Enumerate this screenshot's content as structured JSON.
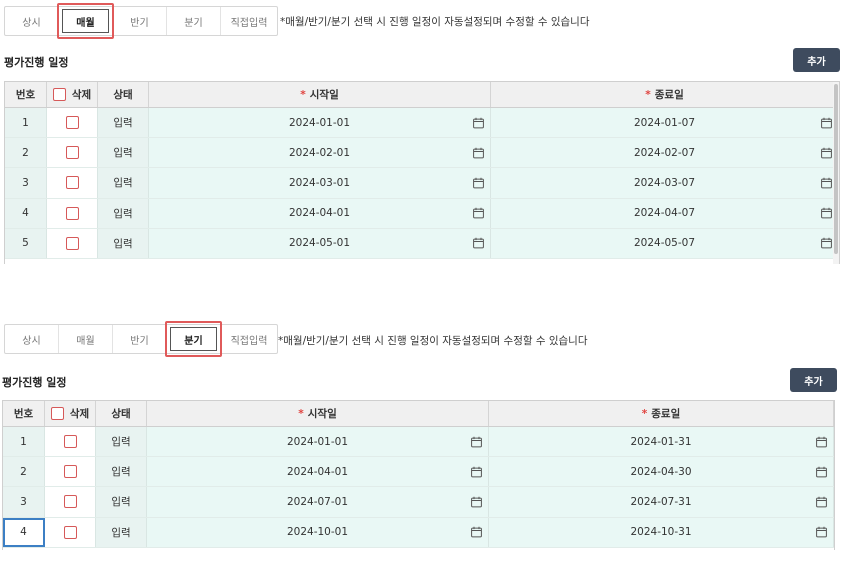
{
  "notice": "*매월/반기/분기 선택 시 진행 일정이 자동설정되며 수정할 수 있습니다",
  "panels": [
    {
      "tabs": [
        {
          "label": "상시",
          "active": false
        },
        {
          "label": "매월",
          "active": true
        },
        {
          "label": "반기",
          "active": false
        },
        {
          "label": "분기",
          "active": false
        },
        {
          "label": "직접입력",
          "active": false
        }
      ],
      "section_title": "평가진행 일정",
      "add_label": "추가",
      "headers": {
        "num": "번호",
        "delete": "삭제",
        "state": "상태",
        "start": "시작일",
        "end": "종료일"
      },
      "rows": [
        {
          "num": "1",
          "state": "입력",
          "start": "2024-01-01",
          "end": "2024-01-07"
        },
        {
          "num": "2",
          "state": "입력",
          "start": "2024-02-01",
          "end": "2024-02-07"
        },
        {
          "num": "3",
          "state": "입력",
          "start": "2024-03-01",
          "end": "2024-03-07"
        },
        {
          "num": "4",
          "state": "입력",
          "start": "2024-04-01",
          "end": "2024-04-07"
        },
        {
          "num": "5",
          "state": "입력",
          "start": "2024-05-01",
          "end": "2024-05-07"
        }
      ]
    },
    {
      "tabs": [
        {
          "label": "상시",
          "active": false
        },
        {
          "label": "매월",
          "active": false
        },
        {
          "label": "반기",
          "active": false
        },
        {
          "label": "분기",
          "active": true
        },
        {
          "label": "직접입력",
          "active": false
        }
      ],
      "section_title": "평가진행 일정",
      "add_label": "추가",
      "headers": {
        "num": "번호",
        "delete": "삭제",
        "state": "상태",
        "start": "시작일",
        "end": "종료일"
      },
      "rows": [
        {
          "num": "1",
          "state": "입력",
          "start": "2024-01-01",
          "end": "2024-01-31"
        },
        {
          "num": "2",
          "state": "입력",
          "start": "2024-04-01",
          "end": "2024-04-30"
        },
        {
          "num": "3",
          "state": "입력",
          "start": "2024-07-01",
          "end": "2024-07-31"
        },
        {
          "num": "4",
          "state": "입력",
          "start": "2024-10-01",
          "end": "2024-10-31",
          "selected": true
        }
      ]
    }
  ],
  "colors": {
    "accent_red": "#e05a5a",
    "button_bg": "#3e4b5e",
    "row_bg": "#e9f8f5",
    "selected_border": "#3c7fc4"
  },
  "icons": {
    "date_picker": "calendar-icon"
  }
}
